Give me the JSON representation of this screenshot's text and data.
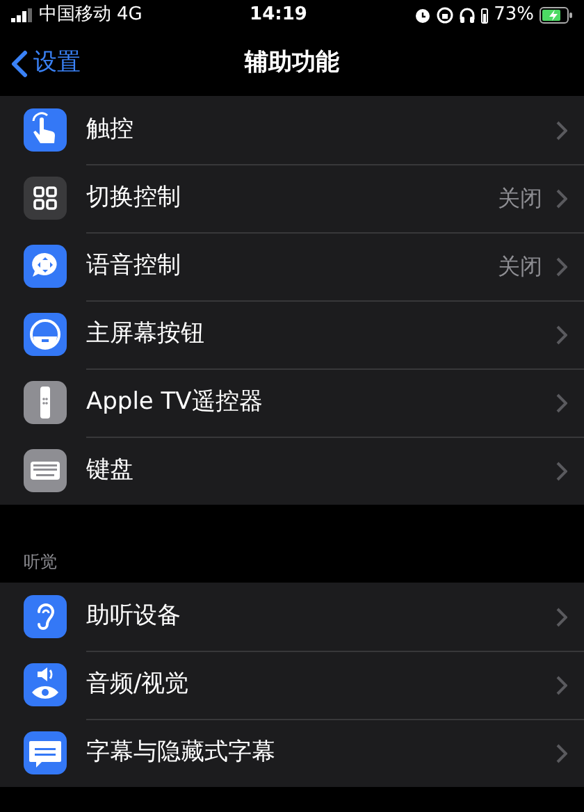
{
  "status_bar": {
    "carrier": "中国移动",
    "network": "4G",
    "time": "14:19",
    "battery_percent": "73%"
  },
  "nav_bar": {
    "back": "设置",
    "title": "辅助功能"
  },
  "sections": [
    {
      "items": [
        {
          "label": "触控",
          "color": "#3478f6"
        },
        {
          "label": "切换控制",
          "value": "关闭",
          "color": "#3a3a3c"
        },
        {
          "label": "语音控制",
          "value": "关闭",
          "color": "#3478f6"
        },
        {
          "label": "主屏幕按钮",
          "color": "#3478f6"
        },
        {
          "label": "Apple TV遥控器",
          "color": "#8e8e93"
        },
        {
          "label": "键盘",
          "color": "#8e8e93"
        }
      ]
    },
    {
      "header": "听觉",
      "items": [
        {
          "label": "助听设备",
          "color": "#3478f6"
        },
        {
          "label": "音频/视觉",
          "color": "#3478f6"
        },
        {
          "label": "字幕与隐藏式字幕",
          "color": "#3478f6"
        }
      ]
    }
  ]
}
